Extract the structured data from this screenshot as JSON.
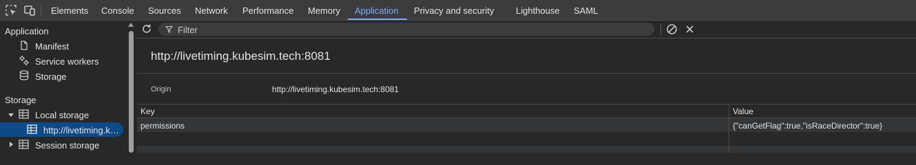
{
  "tabs": [
    "Elements",
    "Console",
    "Sources",
    "Network",
    "Performance",
    "Memory",
    "Application",
    "Privacy and security",
    "Lighthouse",
    "SAML"
  ],
  "active_tab": "Application",
  "sidebar": {
    "application_heading": "Application",
    "application_items": [
      "Manifest",
      "Service workers",
      "Storage"
    ],
    "storage_heading": "Storage",
    "local_storage": "Local storage",
    "local_storage_child": "http://livetiming.k…",
    "session_storage": "Session storage"
  },
  "toolbar": {
    "filter_placeholder": "Filter"
  },
  "main": {
    "origin_title": "http://livetiming.kubesim.tech:8081",
    "origin_label": "Origin",
    "origin_value": "http://livetiming.kubesim.tech:8081"
  },
  "table": {
    "headers": [
      "Key",
      "Value"
    ],
    "rows": [
      {
        "key": "permissions",
        "value": "{\"canGetFlag\":true,\"isRaceDirector\":true}"
      }
    ]
  },
  "colors": {
    "accent": "#7cacf8",
    "selection": "#0e4a87"
  }
}
